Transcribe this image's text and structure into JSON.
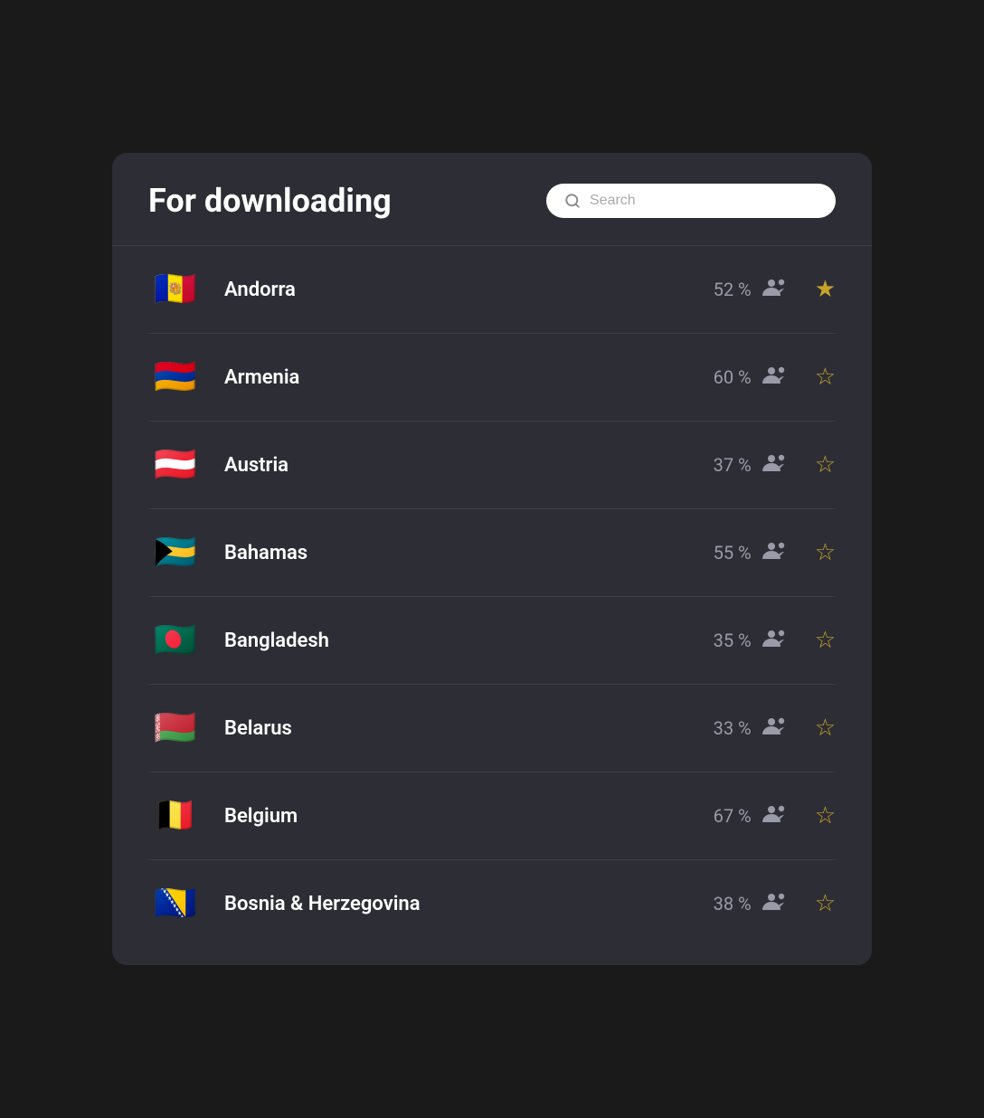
{
  "header": {
    "title": "For downloading",
    "search_placeholder": "Search"
  },
  "countries": [
    {
      "id": "andorra",
      "name": "Andorra",
      "percentage": "52 %",
      "flag_emoji": "🇦🇩",
      "starred": true
    },
    {
      "id": "armenia",
      "name": "Armenia",
      "percentage": "60 %",
      "flag_emoji": "🇦🇲",
      "starred": false
    },
    {
      "id": "austria",
      "name": "Austria",
      "percentage": "37 %",
      "flag_emoji": "🇦🇹",
      "starred": false
    },
    {
      "id": "bahamas",
      "name": "Bahamas",
      "percentage": "55 %",
      "flag_emoji": "🇧🇸",
      "starred": false
    },
    {
      "id": "bangladesh",
      "name": "Bangladesh",
      "percentage": "35 %",
      "flag_emoji": "🇧🇩",
      "starred": false
    },
    {
      "id": "belarus",
      "name": "Belarus",
      "percentage": "33 %",
      "flag_emoji": "🇧🇾",
      "starred": false
    },
    {
      "id": "belgium",
      "name": "Belgium",
      "percentage": "67 %",
      "flag_emoji": "🇧🇪",
      "starred": false
    },
    {
      "id": "bosnia",
      "name": "Bosnia & Herzegovina",
      "percentage": "38 %",
      "flag_emoji": "🇧🇦",
      "starred": false
    }
  ],
  "icons": {
    "star_filled": "★",
    "star_empty": "☆",
    "people": "👥"
  }
}
